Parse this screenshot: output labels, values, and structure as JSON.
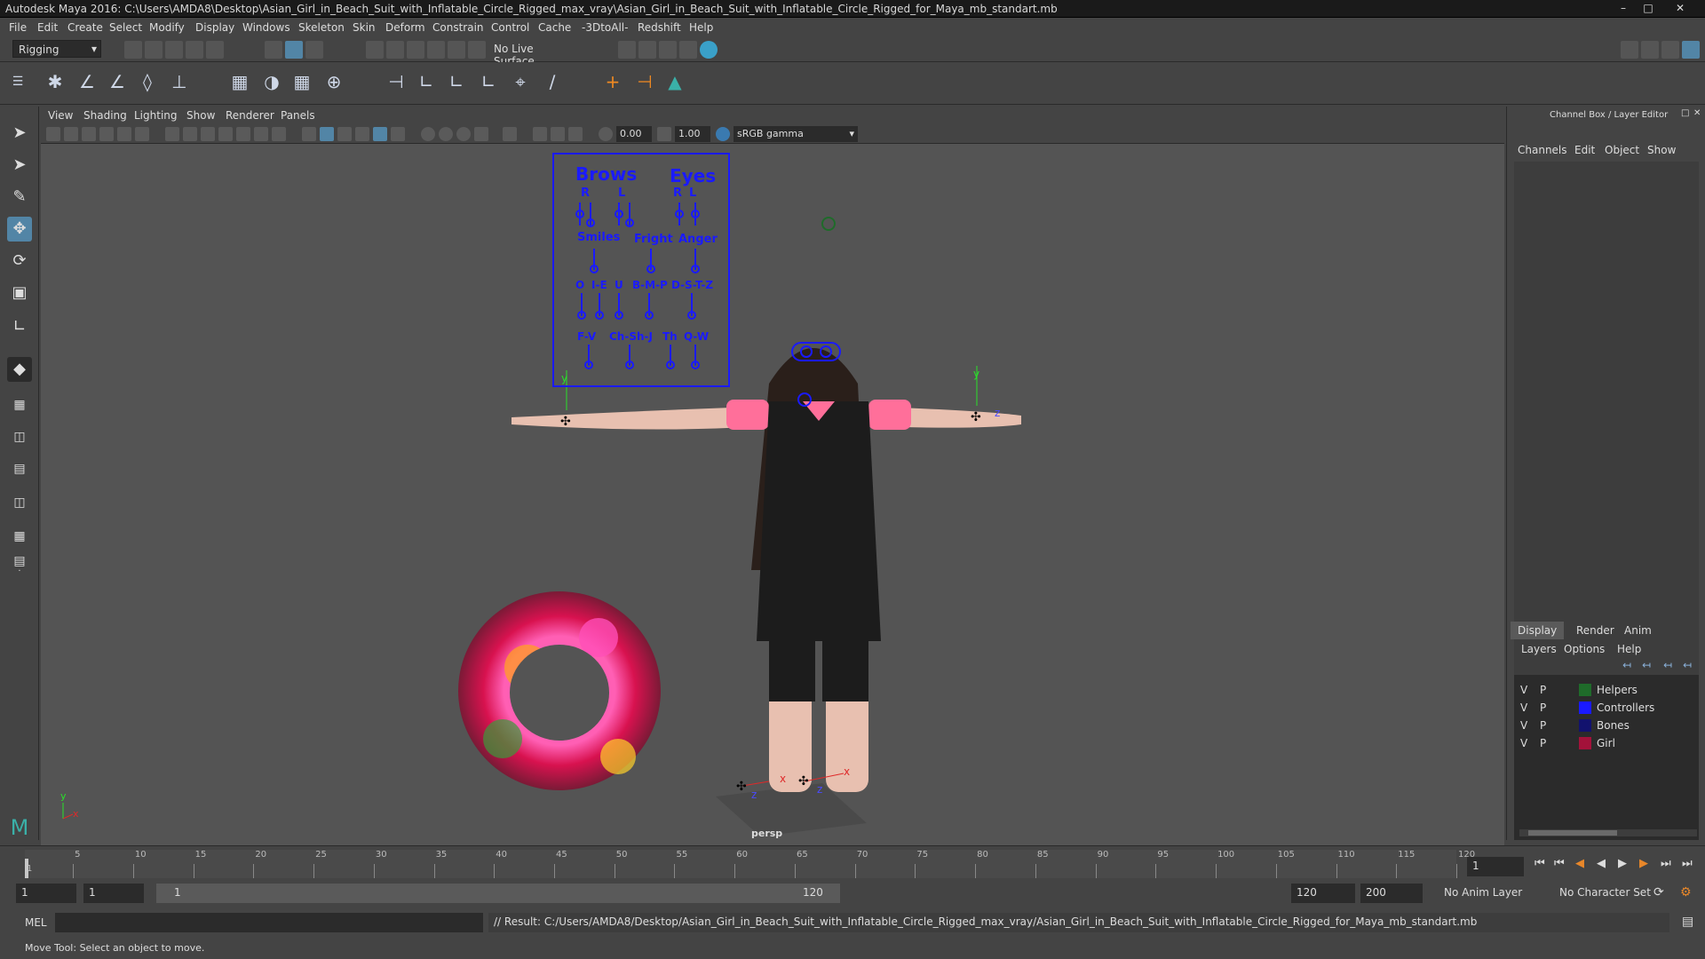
{
  "window": {
    "title": "Autodesk Maya 2016: C:\\Users\\AMDA8\\Desktop\\Asian_Girl_in_Beach_Suit_with_Inflatable_Circle_Rigged_max_vray\\Asian_Girl_in_Beach_Suit_with_Inflatable_Circle_Rigged_for_Maya_mb_standart.mb"
  },
  "menubar": [
    "File",
    "Edit",
    "Create",
    "Select",
    "Modify",
    "Display",
    "Windows",
    "Skeleton",
    "Skin",
    "Deform",
    "Constrain",
    "Control",
    "Cache",
    "-3DtoAll-",
    "Redshift",
    "Help"
  ],
  "statusline": {
    "menuset": "Rigging",
    "live_surface": "No Live Surface"
  },
  "panel": {
    "menus": [
      "View",
      "Shading",
      "Lighting",
      "Show",
      "Renderer",
      "Panels"
    ],
    "exposure": "0.00",
    "gamma": "1.00",
    "color_space": "sRGB gamma",
    "camera_label": "persp"
  },
  "face_panel": {
    "brows": "Brows",
    "eyes": "Eyes",
    "r": "R",
    "l": "L",
    "smiles": "Smiles",
    "fright": "Fright",
    "anger": "Anger",
    "o": "O",
    "ie": "I-E",
    "u": "U",
    "bmp": "B-M-P",
    "dstz": "D-S-T-Z",
    "fv": "F-V",
    "chshj": "Ch-Sh-J",
    "th": "Th",
    "qw": "Q-W"
  },
  "axis": {
    "y": "y",
    "z": "z",
    "x": "x"
  },
  "channel_box": {
    "title": "Channel Box / Layer Editor",
    "menus": [
      "Channels",
      "Edit",
      "Object",
      "Show"
    ],
    "tabs": [
      "Display",
      "Render",
      "Anim"
    ],
    "layer_menus": [
      "Layers",
      "Options",
      "Help"
    ],
    "layers": [
      {
        "v": "V",
        "p": "P",
        "name": "Helpers",
        "color": "#1f6b2a"
      },
      {
        "v": "V",
        "p": "P",
        "name": "Controllers",
        "color": "#1a1aff"
      },
      {
        "v": "V",
        "p": "P",
        "name": "Bones",
        "color": "#12126e"
      },
      {
        "v": "V",
        "p": "P",
        "name": "Girl",
        "color": "#a3123a"
      }
    ]
  },
  "timeline": {
    "ticks": [
      "1",
      "5",
      "10",
      "15",
      "20",
      "25",
      "30",
      "35",
      "40",
      "45",
      "50",
      "55",
      "60",
      "65",
      "70",
      "75",
      "80",
      "85",
      "90",
      "95",
      "100",
      "105",
      "110",
      "115",
      "120"
    ],
    "current_frame": "1"
  },
  "range": {
    "start": "1",
    "anim_start": "1",
    "slider_start": "1",
    "slider_end": "120",
    "range_end": "120",
    "anim_end": "200",
    "anim_layer": "No Anim Layer",
    "char_set": "No Character Set"
  },
  "cmdline": {
    "lang": "MEL",
    "result": "// Result: C:/Users/AMDA8/Desktop/Asian_Girl_in_Beach_Suit_with_Inflatable_Circle_Rigged_max_vray/Asian_Girl_in_Beach_Suit_with_Inflatable_Circle_Rigged_for_Maya_mb_standart.mb"
  },
  "helpline": "Move Tool: Select an object to move."
}
